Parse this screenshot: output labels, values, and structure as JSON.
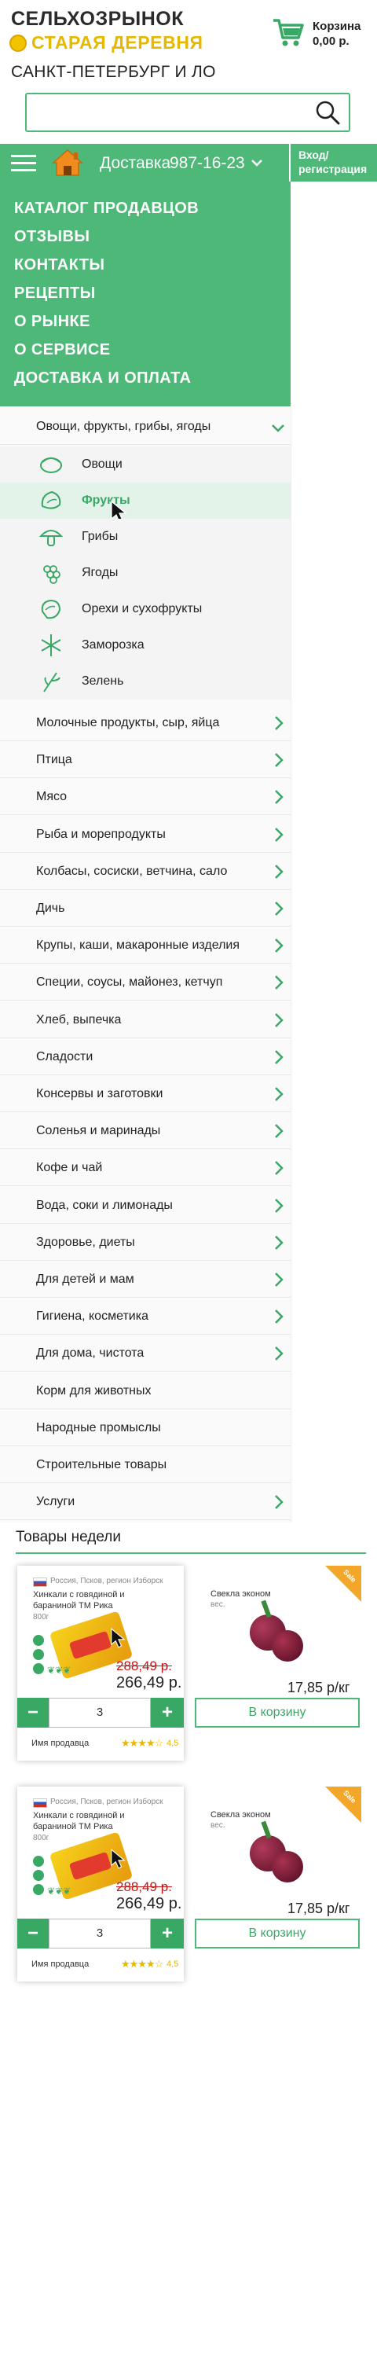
{
  "header": {
    "logo_line1": "СЕЛЬХОЗРЫНОК",
    "logo_line2": "СТАРАЯ ДЕРЕВНЯ",
    "cart_label": "Корзина",
    "cart_sum": "0,00 р.",
    "region": "САНКТ-ПЕТЕРБУРГ И ЛО",
    "search_placeholder": ""
  },
  "navbar": {
    "delivery_label": "Доставка",
    "phone": "987-16-23",
    "login_label": "Вход/ регистрация"
  },
  "main_menu": [
    {
      "label": "КАТАЛОГ ПРОДАВЦОВ"
    },
    {
      "label": "ОТЗЫВЫ"
    },
    {
      "label": "КОНТАКТЫ"
    },
    {
      "label": "РЕЦЕПТЫ"
    },
    {
      "label": "О РЫНКЕ"
    },
    {
      "label": "О СЕРВИСЕ"
    },
    {
      "label": "ДОСТАВКА И ОПЛАТА"
    }
  ],
  "catalog": {
    "open_category": "Овощи, фрукты, грибы, ягоды",
    "subcategories": [
      {
        "label": "Овощи",
        "icon": "vegetables-icon"
      },
      {
        "label": "Фрукты",
        "icon": "fruit-icon",
        "active": true
      },
      {
        "label": "Грибы",
        "icon": "mushroom-icon"
      },
      {
        "label": "Ягоды",
        "icon": "berries-icon"
      },
      {
        "label": "Орехи и сухофрукты",
        "icon": "nuts-icon"
      },
      {
        "label": "Заморозка",
        "icon": "snowflake-icon"
      },
      {
        "label": "Зелень",
        "icon": "herbs-icon"
      }
    ],
    "categories": [
      {
        "label": "Молочные продукты, сыр, яйца",
        "has_children": true
      },
      {
        "label": "Птица",
        "has_children": true
      },
      {
        "label": "Мясо",
        "has_children": true
      },
      {
        "label": "Рыба и морепродукты",
        "has_children": true
      },
      {
        "label": "Колбасы, сосиски, ветчина, сало",
        "has_children": true
      },
      {
        "label": "Дичь",
        "has_children": true
      },
      {
        "label": "Крупы, каши, макаронные изделия",
        "has_children": true
      },
      {
        "label": "Специи, соусы, майонез, кетчуп",
        "has_children": true
      },
      {
        "label": "Хлеб, выпечка",
        "has_children": true
      },
      {
        "label": "Сладости",
        "has_children": true
      },
      {
        "label": "Консервы и заготовки",
        "has_children": true
      },
      {
        "label": "Соленья и маринады",
        "has_children": true
      },
      {
        "label": "Кофе и чай",
        "has_children": true
      },
      {
        "label": "Вода, соки и лимонады",
        "has_children": true
      },
      {
        "label": "Здоровье, диеты",
        "has_children": true
      },
      {
        "label": "Для детей и мам",
        "has_children": true
      },
      {
        "label": "Гигиена, косметика",
        "has_children": true
      },
      {
        "label": "Для дома, чистота",
        "has_children": true
      },
      {
        "label": "Корм для животных",
        "has_children": false
      },
      {
        "label": "Народные промыслы",
        "has_children": false
      },
      {
        "label": "Строительные товары",
        "has_children": false
      },
      {
        "label": "Услуги",
        "has_children": true
      }
    ]
  },
  "products_section": {
    "title": "Товары недели",
    "cards": [
      {
        "region": "Россия, Псков, регион Изборск",
        "name": "Хинкали с говядиной и бараниной ТМ Рика",
        "weight": "800г",
        "old_price": "288,49 р.",
        "new_price": "266,49 р.",
        "qty": "3",
        "seller": "Имя продавца",
        "rating": "4,5",
        "rating_value": 4.5,
        "minus": "−",
        "plus": "+",
        "side_name": "Свекла эконом",
        "side_weight": "вес.",
        "side_price": "17,85 р/кг",
        "to_cart": "В корзину",
        "badge": "Sale"
      },
      {
        "region": "Россия, Псков, регион Изборск",
        "name": "Хинкали с говядиной и бараниной ТМ Рика",
        "weight": "800г",
        "old_price": "288,49 р.",
        "new_price": "266,49 р.",
        "qty": "3",
        "seller": "Имя продавца",
        "rating": "4,5",
        "rating_value": 4.5,
        "minus": "−",
        "plus": "+",
        "side_name": "Свекла эконом",
        "side_weight": "вес.",
        "side_price": "17,85 р/кг",
        "to_cart": "В корзину",
        "badge": "Sale"
      }
    ]
  },
  "colors": {
    "brand_green": "#4db877",
    "dark_green": "#3aa865",
    "logo_yellow": "#e6b800",
    "sale_orange": "#f3a72a",
    "price_red": "#c01818"
  }
}
